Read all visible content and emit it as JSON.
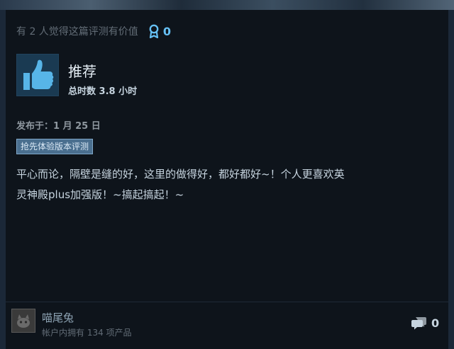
{
  "review": {
    "helpful_text": "有 2 人觉得这篇评测有价值",
    "award_count": "0",
    "recommendation": "推荐",
    "hours": "总时数 3.8 小时",
    "posted": "发布于：1 月 25 日",
    "early_access_badge": "抢先体验版本评测",
    "content_line1": "平心而论，隔壁是缝的好，这里的做得好，都好都好~！个人更喜欢英",
    "content_line2": "灵神殿plus加强版！~搞起搞起！~"
  },
  "author": {
    "name": "喵尾兔",
    "products_owned": "帐户内拥有 134 项产品"
  },
  "comments": {
    "count": "0"
  },
  "icons": {
    "award": "award-ribbon-icon",
    "thumb": "thumbs-up-icon",
    "comment": "comment-bubbles-icon"
  },
  "colors": {
    "background": "#1b2838",
    "card": "#0e141b",
    "accent": "#66c0f4",
    "text": "#c6d4df",
    "muted": "#626c76"
  }
}
